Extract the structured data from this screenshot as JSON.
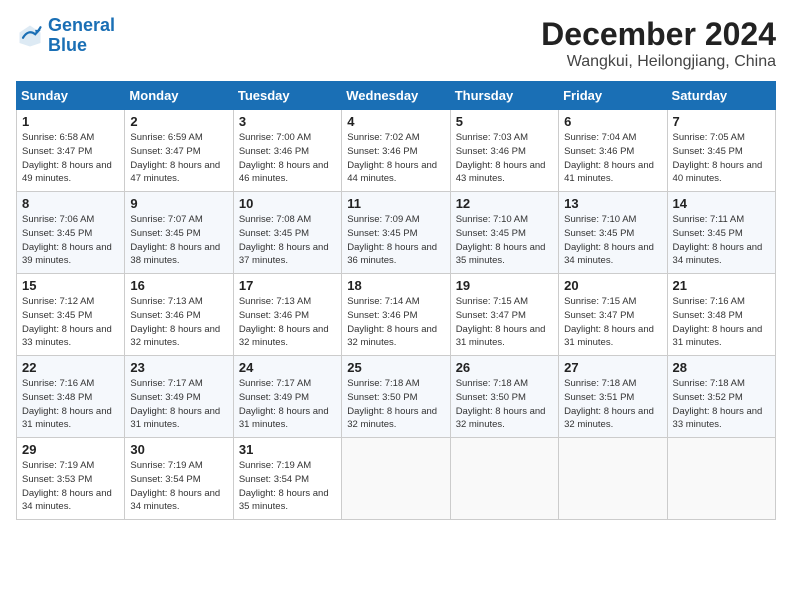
{
  "header": {
    "logo_line1": "General",
    "logo_line2": "Blue",
    "month": "December 2024",
    "location": "Wangkui, Heilongjiang, China"
  },
  "weekdays": [
    "Sunday",
    "Monday",
    "Tuesday",
    "Wednesday",
    "Thursday",
    "Friday",
    "Saturday"
  ],
  "weeks": [
    [
      {
        "day": "1",
        "sunrise": "6:58 AM",
        "sunset": "3:47 PM",
        "daylight": "8 hours and 49 minutes."
      },
      {
        "day": "2",
        "sunrise": "6:59 AM",
        "sunset": "3:47 PM",
        "daylight": "8 hours and 47 minutes."
      },
      {
        "day": "3",
        "sunrise": "7:00 AM",
        "sunset": "3:46 PM",
        "daylight": "8 hours and 46 minutes."
      },
      {
        "day": "4",
        "sunrise": "7:02 AM",
        "sunset": "3:46 PM",
        "daylight": "8 hours and 44 minutes."
      },
      {
        "day": "5",
        "sunrise": "7:03 AM",
        "sunset": "3:46 PM",
        "daylight": "8 hours and 43 minutes."
      },
      {
        "day": "6",
        "sunrise": "7:04 AM",
        "sunset": "3:46 PM",
        "daylight": "8 hours and 41 minutes."
      },
      {
        "day": "7",
        "sunrise": "7:05 AM",
        "sunset": "3:45 PM",
        "daylight": "8 hours and 40 minutes."
      }
    ],
    [
      {
        "day": "8",
        "sunrise": "7:06 AM",
        "sunset": "3:45 PM",
        "daylight": "8 hours and 39 minutes."
      },
      {
        "day": "9",
        "sunrise": "7:07 AM",
        "sunset": "3:45 PM",
        "daylight": "8 hours and 38 minutes."
      },
      {
        "day": "10",
        "sunrise": "7:08 AM",
        "sunset": "3:45 PM",
        "daylight": "8 hours and 37 minutes."
      },
      {
        "day": "11",
        "sunrise": "7:09 AM",
        "sunset": "3:45 PM",
        "daylight": "8 hours and 36 minutes."
      },
      {
        "day": "12",
        "sunrise": "7:10 AM",
        "sunset": "3:45 PM",
        "daylight": "8 hours and 35 minutes."
      },
      {
        "day": "13",
        "sunrise": "7:10 AM",
        "sunset": "3:45 PM",
        "daylight": "8 hours and 34 minutes."
      },
      {
        "day": "14",
        "sunrise": "7:11 AM",
        "sunset": "3:45 PM",
        "daylight": "8 hours and 34 minutes."
      }
    ],
    [
      {
        "day": "15",
        "sunrise": "7:12 AM",
        "sunset": "3:45 PM",
        "daylight": "8 hours and 33 minutes."
      },
      {
        "day": "16",
        "sunrise": "7:13 AM",
        "sunset": "3:46 PM",
        "daylight": "8 hours and 32 minutes."
      },
      {
        "day": "17",
        "sunrise": "7:13 AM",
        "sunset": "3:46 PM",
        "daylight": "8 hours and 32 minutes."
      },
      {
        "day": "18",
        "sunrise": "7:14 AM",
        "sunset": "3:46 PM",
        "daylight": "8 hours and 32 minutes."
      },
      {
        "day": "19",
        "sunrise": "7:15 AM",
        "sunset": "3:47 PM",
        "daylight": "8 hours and 31 minutes."
      },
      {
        "day": "20",
        "sunrise": "7:15 AM",
        "sunset": "3:47 PM",
        "daylight": "8 hours and 31 minutes."
      },
      {
        "day": "21",
        "sunrise": "7:16 AM",
        "sunset": "3:48 PM",
        "daylight": "8 hours and 31 minutes."
      }
    ],
    [
      {
        "day": "22",
        "sunrise": "7:16 AM",
        "sunset": "3:48 PM",
        "daylight": "8 hours and 31 minutes."
      },
      {
        "day": "23",
        "sunrise": "7:17 AM",
        "sunset": "3:49 PM",
        "daylight": "8 hours and 31 minutes."
      },
      {
        "day": "24",
        "sunrise": "7:17 AM",
        "sunset": "3:49 PM",
        "daylight": "8 hours and 31 minutes."
      },
      {
        "day": "25",
        "sunrise": "7:18 AM",
        "sunset": "3:50 PM",
        "daylight": "8 hours and 32 minutes."
      },
      {
        "day": "26",
        "sunrise": "7:18 AM",
        "sunset": "3:50 PM",
        "daylight": "8 hours and 32 minutes."
      },
      {
        "day": "27",
        "sunrise": "7:18 AM",
        "sunset": "3:51 PM",
        "daylight": "8 hours and 32 minutes."
      },
      {
        "day": "28",
        "sunrise": "7:18 AM",
        "sunset": "3:52 PM",
        "daylight": "8 hours and 33 minutes."
      }
    ],
    [
      {
        "day": "29",
        "sunrise": "7:19 AM",
        "sunset": "3:53 PM",
        "daylight": "8 hours and 34 minutes."
      },
      {
        "day": "30",
        "sunrise": "7:19 AM",
        "sunset": "3:54 PM",
        "daylight": "8 hours and 34 minutes."
      },
      {
        "day": "31",
        "sunrise": "7:19 AM",
        "sunset": "3:54 PM",
        "daylight": "8 hours and 35 minutes."
      },
      null,
      null,
      null,
      null
    ]
  ]
}
